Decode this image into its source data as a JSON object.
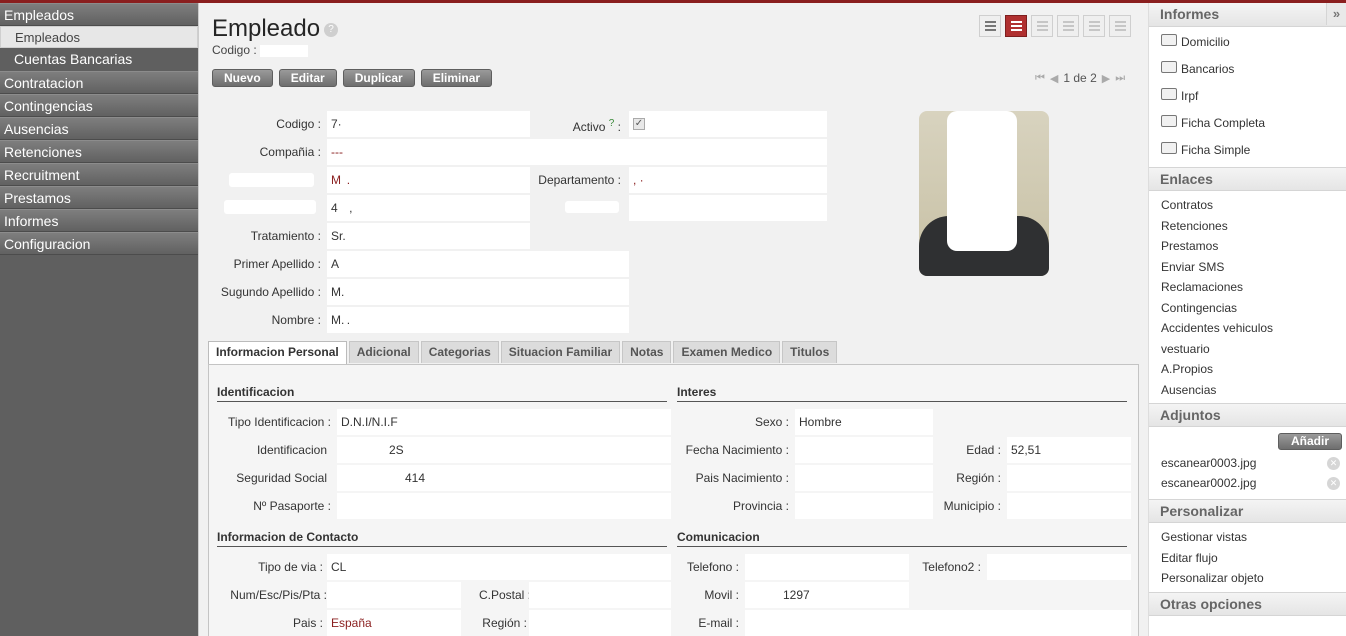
{
  "menu": {
    "items": [
      {
        "label": "Empleados"
      },
      {
        "label": "Contratacion"
      },
      {
        "label": "Contingencias"
      },
      {
        "label": "Ausencias"
      },
      {
        "label": "Retenciones"
      },
      {
        "label": "Recruitment"
      },
      {
        "label": "Prestamos"
      },
      {
        "label": "Informes"
      },
      {
        "label": "Configuracion"
      }
    ],
    "subitems": [
      {
        "label": "Empleados"
      },
      {
        "label": "Cuentas Bancarias"
      }
    ]
  },
  "header": {
    "title": "Empleado",
    "help": "?",
    "code_label": "Codigo :"
  },
  "toolbar": {
    "nuevo": "Nuevo",
    "editar": "Editar",
    "duplicar": "Duplicar",
    "eliminar": "Eliminar"
  },
  "pager": {
    "text": "1 de 2"
  },
  "form": {
    "codigo_label": "Codigo :",
    "codigo_value": "7·",
    "activo_label": "Activo",
    "activo_help": "?",
    "activo_colon": ":",
    "activo_checked": true,
    "compania_label": "Compañia :",
    "compania_value": "---",
    "unnamed_value_1": "M  .",
    "departamento_label": "Departamento :",
    "departamento_value": ", ·",
    "unnamed_value_2": "4    ,",
    "tratamiento_label": "Tratamiento :",
    "tratamiento_value": "Sr.",
    "primer_apellido_label": "Primer Apellido :",
    "primer_apellido_value": "A ",
    "segundo_apellido_label": "Sugundo Apellido :",
    "segundo_apellido_value": "M.",
    "nombre_label": "Nombre :",
    "nombre_value": "M. ."
  },
  "tabs": [
    {
      "label": "Informacion Personal",
      "active": true
    },
    {
      "label": "Adicional"
    },
    {
      "label": "Categorias"
    },
    {
      "label": "Situacion Familiar"
    },
    {
      "label": "Notas"
    },
    {
      "label": "Examen Medico"
    },
    {
      "label": "Titulos"
    }
  ],
  "personal": {
    "identificacion_section": "Identificacion",
    "interes_section": "Interes",
    "tipo_ident_label": "Tipo Identificacion :",
    "tipo_ident_value": "D.N.I/N.I.F",
    "ident_label": "Identificacion",
    "ident_value": "2S",
    "seg_social_label": "Seguridad Social",
    "seg_social_value": "414",
    "pasaporte_label": "Nº Pasaporte :",
    "sexo_label": "Sexo :",
    "sexo_value": "Hombre",
    "fecha_nac_label": "Fecha Nacimiento :",
    "edad_label": "Edad :",
    "edad_value": "52,51",
    "pais_nac_label": "Pais Nacimiento :",
    "region_label": "Región :",
    "provincia_label": "Provincia :",
    "municipio_label": "Municipio :",
    "contacto_section": "Informacion de Contacto",
    "comunicacion_section": "Comunicacion",
    "tipo_via_label": "Tipo de via :",
    "tipo_via_value": "CL",
    "num_label": "Num/Esc/Pis/Pta :",
    "cpostal_label": "C.Postal :",
    "pais_label": "Pais :",
    "pais_value": "España",
    "region2_label": "Región :",
    "telefono_label": "Telefono :",
    "telefono2_label": "Telefono2 :",
    "movil_label": "Movil :",
    "movil_value": "1297",
    "email_label": "E-mail :"
  },
  "right": {
    "informes_title": "Informes",
    "collapse": "»",
    "reports": [
      {
        "label": "Domicilio"
      },
      {
        "label": "Bancarios"
      },
      {
        "label": "Irpf"
      },
      {
        "label": "Ficha Completa"
      },
      {
        "label": "Ficha Simple"
      }
    ],
    "enlaces_title": "Enlaces",
    "links": [
      {
        "label": "Contratos"
      },
      {
        "label": "Retenciones"
      },
      {
        "label": "Prestamos"
      },
      {
        "label": "Enviar SMS"
      },
      {
        "label": "Reclamaciones"
      },
      {
        "label": "Contingencias"
      },
      {
        "label": "Accidentes vehiculos"
      },
      {
        "label": "vestuario"
      },
      {
        "label": "A.Propios"
      },
      {
        "label": "Ausencias"
      }
    ],
    "adjuntos_title": "Adjuntos",
    "add_label": "Añadir",
    "attachments": [
      {
        "label": "escanear0003.jpg"
      },
      {
        "label": "escanear0002.jpg"
      }
    ],
    "personalizar_title": "Personalizar",
    "custom": [
      {
        "label": "Gestionar vistas"
      },
      {
        "label": "Editar flujo"
      },
      {
        "label": "Personalizar objeto"
      }
    ],
    "otras_title": "Otras opciones"
  }
}
